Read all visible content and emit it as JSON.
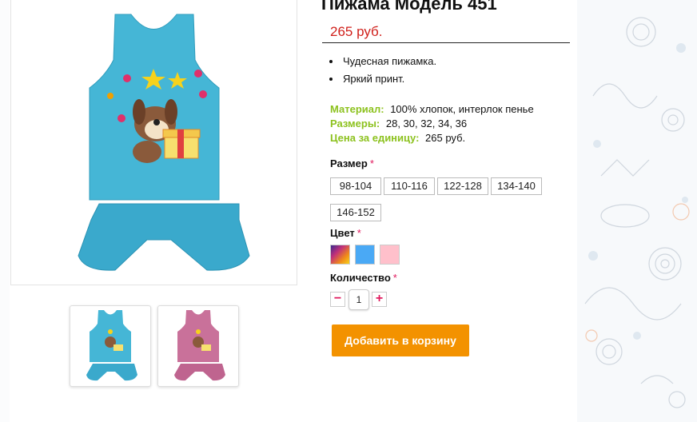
{
  "product": {
    "title": "Пижама Модель 451",
    "price": "265 руб.",
    "features": [
      "Чудесная пижамка.",
      "Яркий принт."
    ],
    "specs": [
      {
        "label": "Материал:",
        "value": "100% хлопок, интерлок пенье"
      },
      {
        "label": "Размеры:",
        "value": "28, 30, 32, 34, 36"
      },
      {
        "label": "Цена за единицу:",
        "value": "265 руб."
      }
    ]
  },
  "options": {
    "size_label": "Размер",
    "sizes": [
      "98-104",
      "110-116",
      "122-128",
      "134-140",
      "146-152"
    ],
    "color_label": "Цвет",
    "colors": [
      "multicolor",
      "#4aa9f5",
      "#ffc0cb"
    ],
    "quantity_label": "Количество",
    "quantity": "1",
    "required_mark": "*",
    "minus": "−",
    "plus": "+"
  },
  "cart_button": "Добавить в корзину",
  "colors": {
    "price": "#d0201b",
    "spec_label": "#8dc21f",
    "button": "#f39200",
    "required": "#e0195d"
  }
}
